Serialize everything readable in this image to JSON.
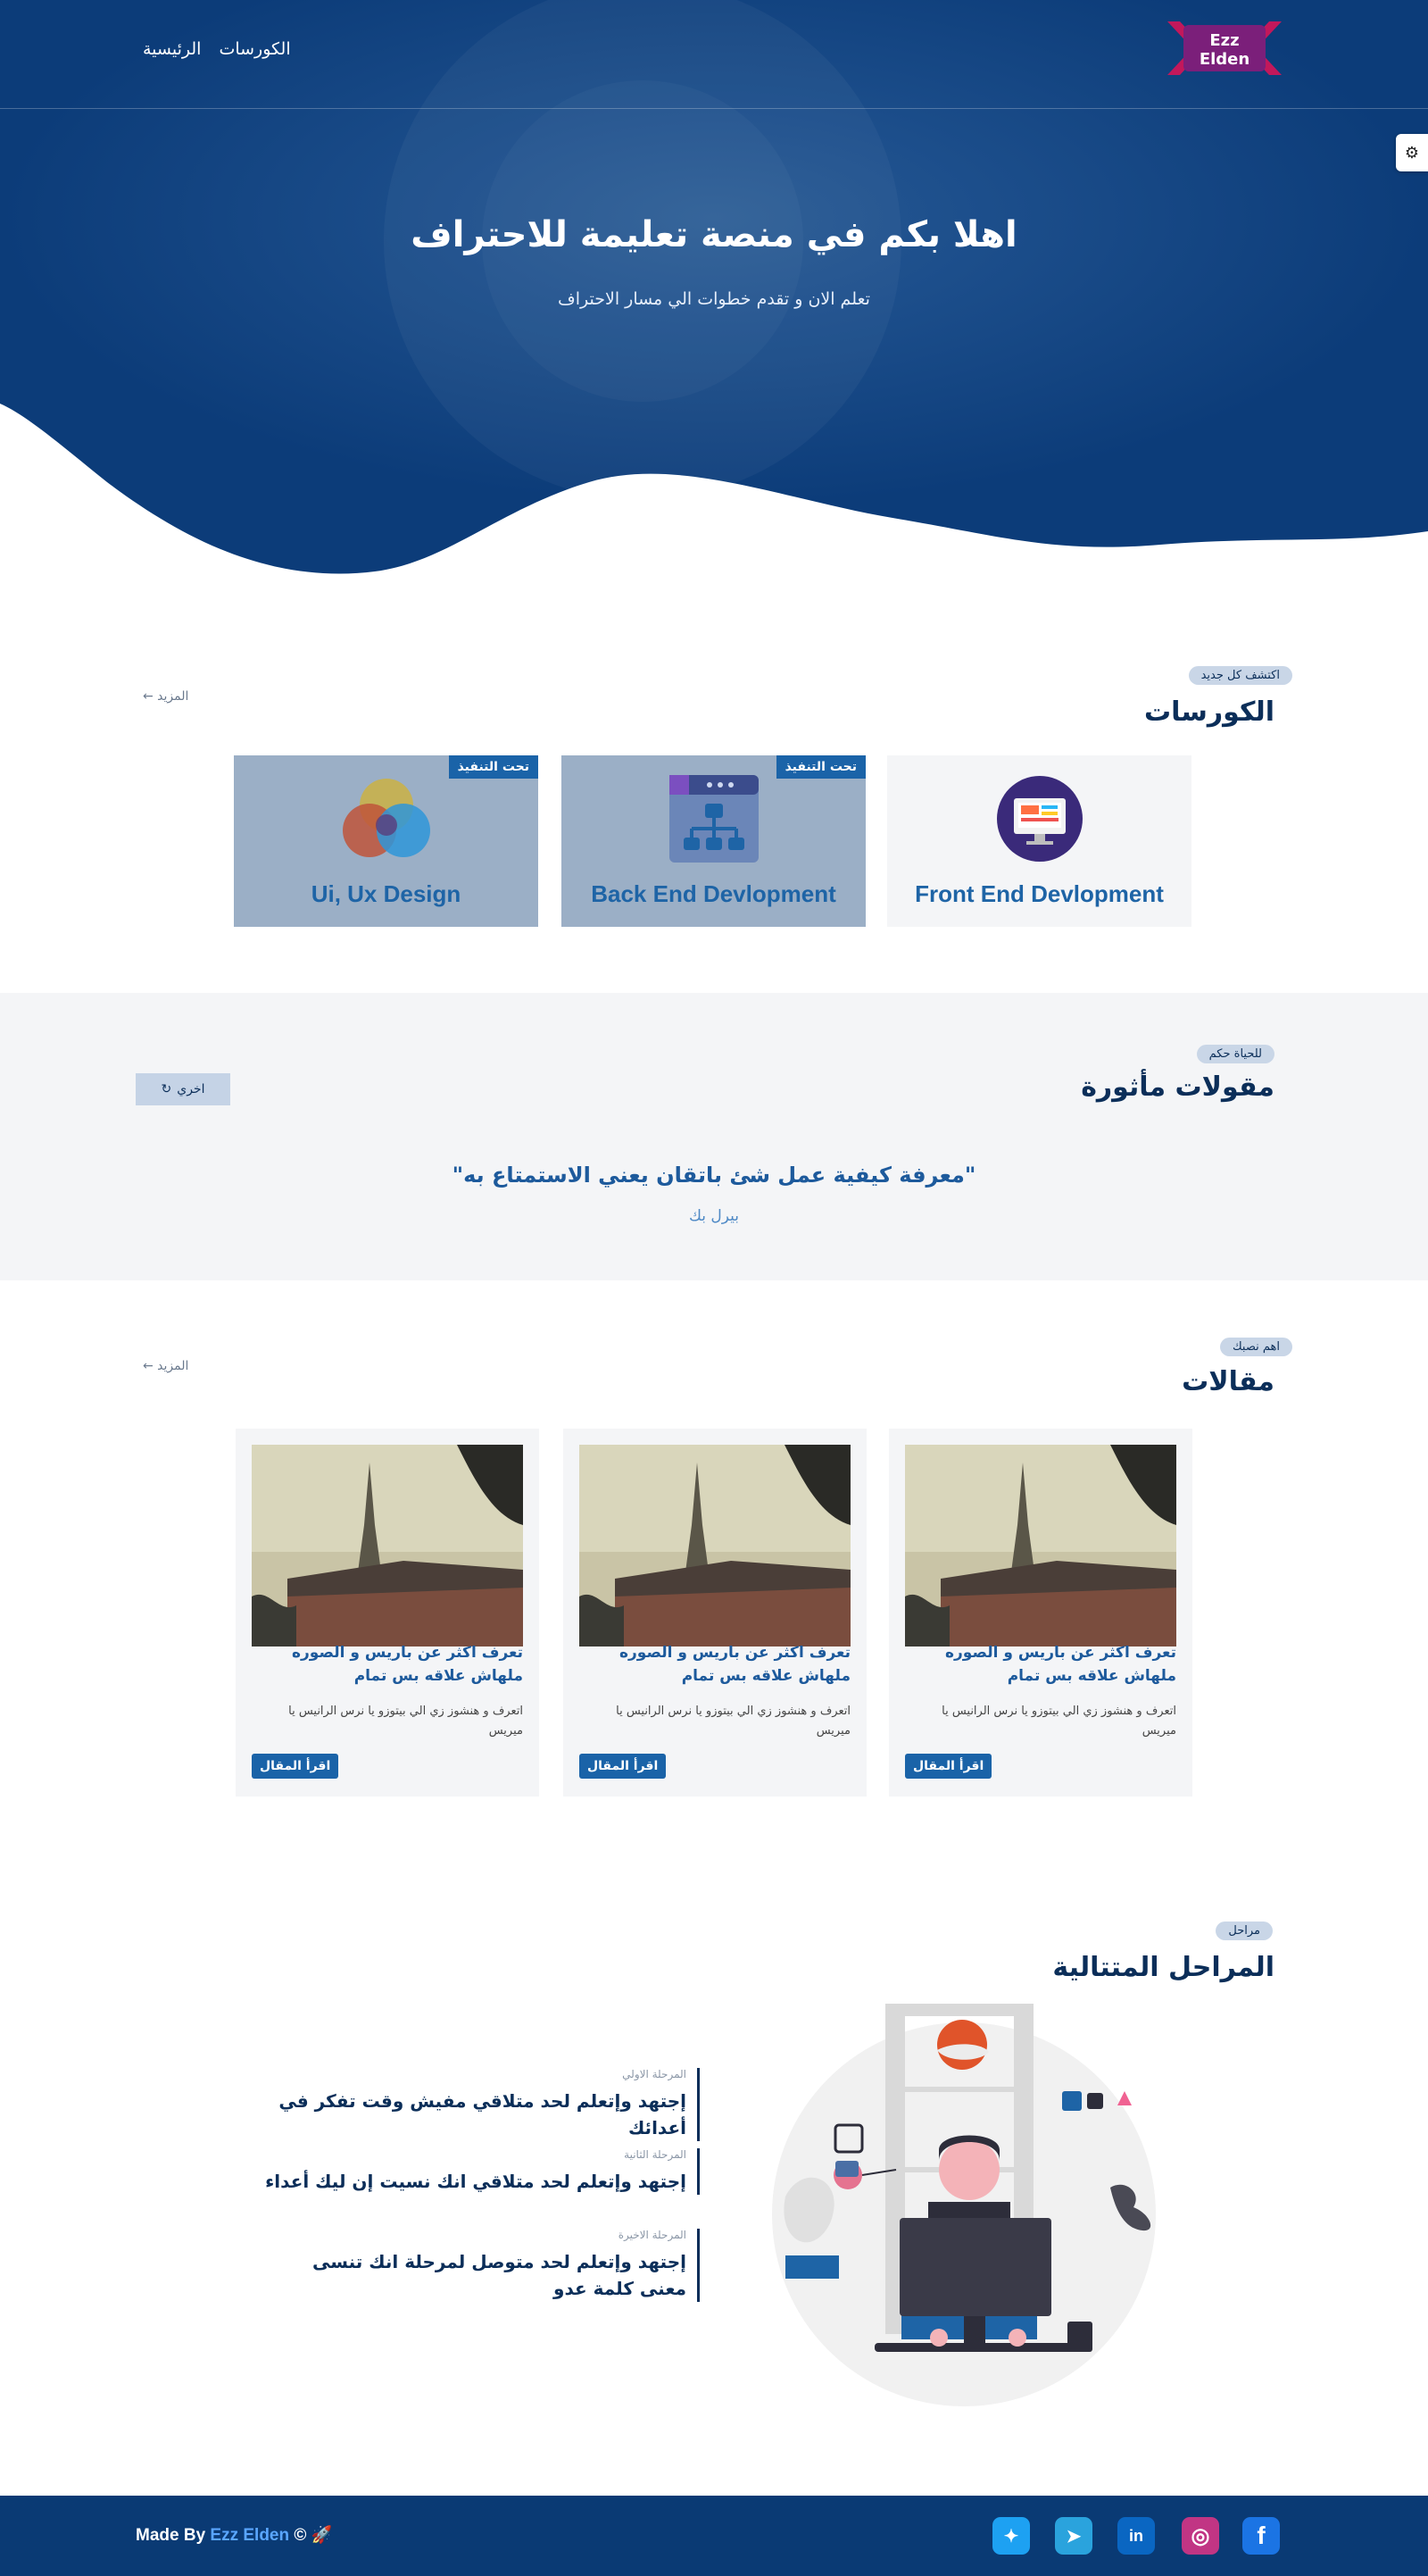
{
  "nav": {
    "home": "الرئيسية",
    "courses": "الكورسات",
    "logo_text": "Ezz Elden"
  },
  "hero": {
    "title": "اهلا بكم في منصة تعليمة للاحتراف",
    "subtitle": "تعلم الان و تقدم خطوات الي مسار الاحتراف"
  },
  "courses_section": {
    "badge": "اكتشف كل جديد",
    "title": "الكورسات",
    "more": "المزيد ←",
    "cards": [
      {
        "title": "Front End Devlopment",
        "tag": "",
        "icon": "monitor-icon"
      },
      {
        "title": "Back End Devlopment",
        "tag": "تحت التنفيذ",
        "icon": "network-icon"
      },
      {
        "title": "Ui, Ux Design",
        "tag": "تحت التنفيذ",
        "icon": "color-circles-icon"
      }
    ]
  },
  "quotes_section": {
    "badge": "للحياة حكم",
    "title": "مقولات مأثورة",
    "other": "اخري",
    "quote": "\"معرفة كيفية عمل شئ باتقان يعني الاستمتاع به\"",
    "author": "بيرل بك"
  },
  "articles_section": {
    "badge": "اهم نصبك",
    "title": "مقالات",
    "more": "المزيد ←",
    "cards": [
      {
        "title": "تعرف اكثر عن باريس و الصوره ملهاش علاقه بس تمام",
        "desc": "اتعرف و هنشوز زي الي بيتوزو يا نرس الرانيس يا ميريس",
        "button": "اقرأ المقال"
      },
      {
        "title": "تعرف اكثر عن باريس و الصوره ملهاش علاقه بس تمام",
        "desc": "اتعرف و هنشوز زي الي بيتوزو يا نرس الرانيس يا ميريس",
        "button": "اقرأ المقال"
      },
      {
        "title": "تعرف اكثر عن باريس و الصوره ملهاش علاقه بس تمام",
        "desc": "اتعرف و هنشوز زي الي بيتوزو يا نرس الرانيس يا ميريس",
        "button": "اقرأ المقال"
      }
    ]
  },
  "stages_section": {
    "badge": "مراحل",
    "title": "المراحل المتتالية",
    "steps": [
      {
        "label": "المرحلة الاولي",
        "text": "إجتهد وإتعلم لحد متلاقي مفيش وقت تفكر في أعدائك"
      },
      {
        "label": "المرحلة الثانية",
        "text": "إجتهد وإتعلم لحد متلاقي انك نسيت إن ليك أعداء"
      },
      {
        "label": "المرحلة الاخيرة",
        "text": "إجتهد وإتعلم لحد متوصل لمرحلة انك تنسى معنى كلمة عدو"
      }
    ]
  },
  "footer": {
    "made_by": "Made By",
    "name": "Ezz Elden",
    "suffix": "© 🚀",
    "social": [
      {
        "name": "facebook-icon",
        "glyph": "f",
        "color": "#1b74e4"
      },
      {
        "name": "instagram-icon",
        "glyph": "◎",
        "color": "#c13584"
      },
      {
        "name": "linkedin-icon",
        "glyph": "in",
        "color": "#0a66c2"
      },
      {
        "name": "telegram-icon",
        "glyph": "➤",
        "color": "#2aa3dd"
      },
      {
        "name": "twitter-icon",
        "glyph": "✦",
        "color": "#1da1f2"
      }
    ]
  },
  "colors": {
    "primary": "#0b3a78",
    "accent": "#1a63a8",
    "light": "#f4f5f7"
  }
}
